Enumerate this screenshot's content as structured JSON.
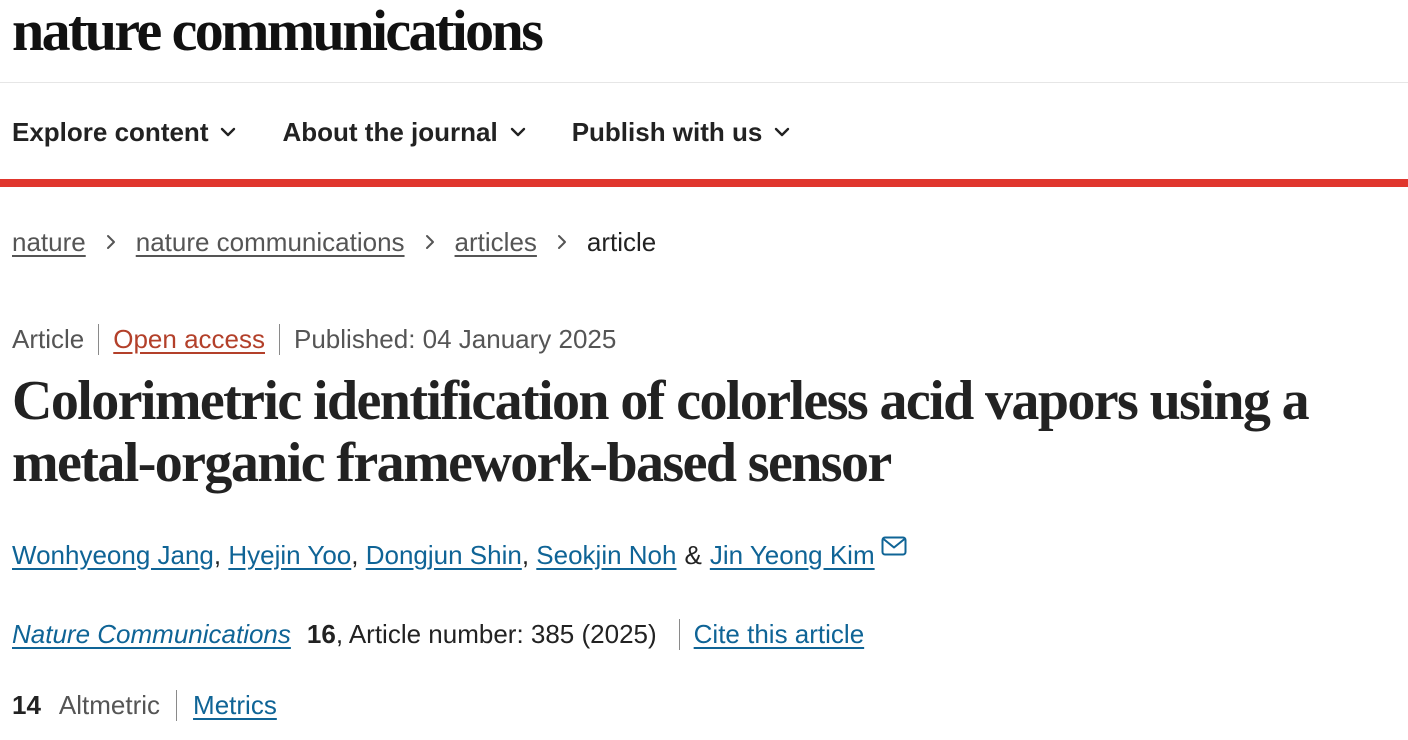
{
  "site": {
    "logo": "nature communications"
  },
  "nav": {
    "items": [
      {
        "label": "Explore content",
        "icon": "chevron-down-icon"
      },
      {
        "label": "About the journal",
        "icon": "chevron-down-icon"
      },
      {
        "label": "Publish with us",
        "icon": "chevron-down-icon"
      }
    ]
  },
  "breadcrumb": {
    "items": [
      "nature",
      "nature communications",
      "articles"
    ],
    "current": "article",
    "separator_icon": "chevron-right-icon"
  },
  "article": {
    "type": "Article",
    "access": "Open access",
    "published": "Published: 04 January 2025",
    "title": "Colorimetric identification of colorless acid vapors using a metal-organic framework-based sensor",
    "authors": [
      "Wonhyeong Jang",
      "Hyejin Yoo",
      "Dongjun Shin",
      "Seokjin Noh",
      "Jin Yeong Kim"
    ],
    "author_separator": ", ",
    "last_separator": "&",
    "corresponding_icon": "mail-icon"
  },
  "citation": {
    "journal": "Nature Communications",
    "volume": "16",
    "article_number_text": ", Article number: 385 (2025)",
    "cite_label": "Cite this article"
  },
  "metrics": {
    "altmetric_score": "14",
    "altmetric_label": "Altmetric",
    "metrics_label": "Metrics"
  },
  "colors": {
    "accent_red": "#e0362d",
    "link_blue": "#0f6496",
    "open_access_orange": "#b3402a",
    "text": "#222222",
    "muted_text": "#555555"
  }
}
